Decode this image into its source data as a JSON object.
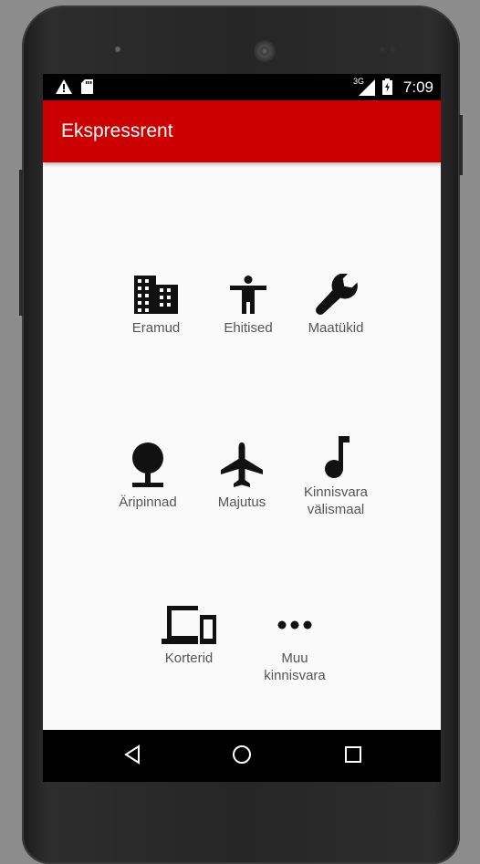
{
  "status_bar": {
    "time": "7:09",
    "network": "3G",
    "left_icons": [
      "warning-icon",
      "sd-card-icon"
    ],
    "right_icons": [
      "signal-icon",
      "battery-icon"
    ]
  },
  "app_bar": {
    "title": "Ekspressrent",
    "background_color": "#cc0000"
  },
  "categories": [
    {
      "label": "Eramud",
      "icon": "building-icon"
    },
    {
      "label": "Ehitised",
      "icon": "accessibility-person-icon"
    },
    {
      "label": "Maatükid",
      "icon": "wrench-icon"
    },
    {
      "label": "Äripinnad",
      "icon": "tree-icon"
    },
    {
      "label": "Majutus",
      "icon": "airplane-icon"
    },
    {
      "label": "Kinnisvara välismaal",
      "icon": "music-note-icon"
    },
    {
      "label": "Korterid",
      "icon": "devices-icon"
    },
    {
      "label": "Muu kinnisvara",
      "icon": "more-dots-icon"
    }
  ],
  "nav_bar": {
    "buttons": [
      "back-icon",
      "home-icon",
      "recents-icon"
    ]
  }
}
